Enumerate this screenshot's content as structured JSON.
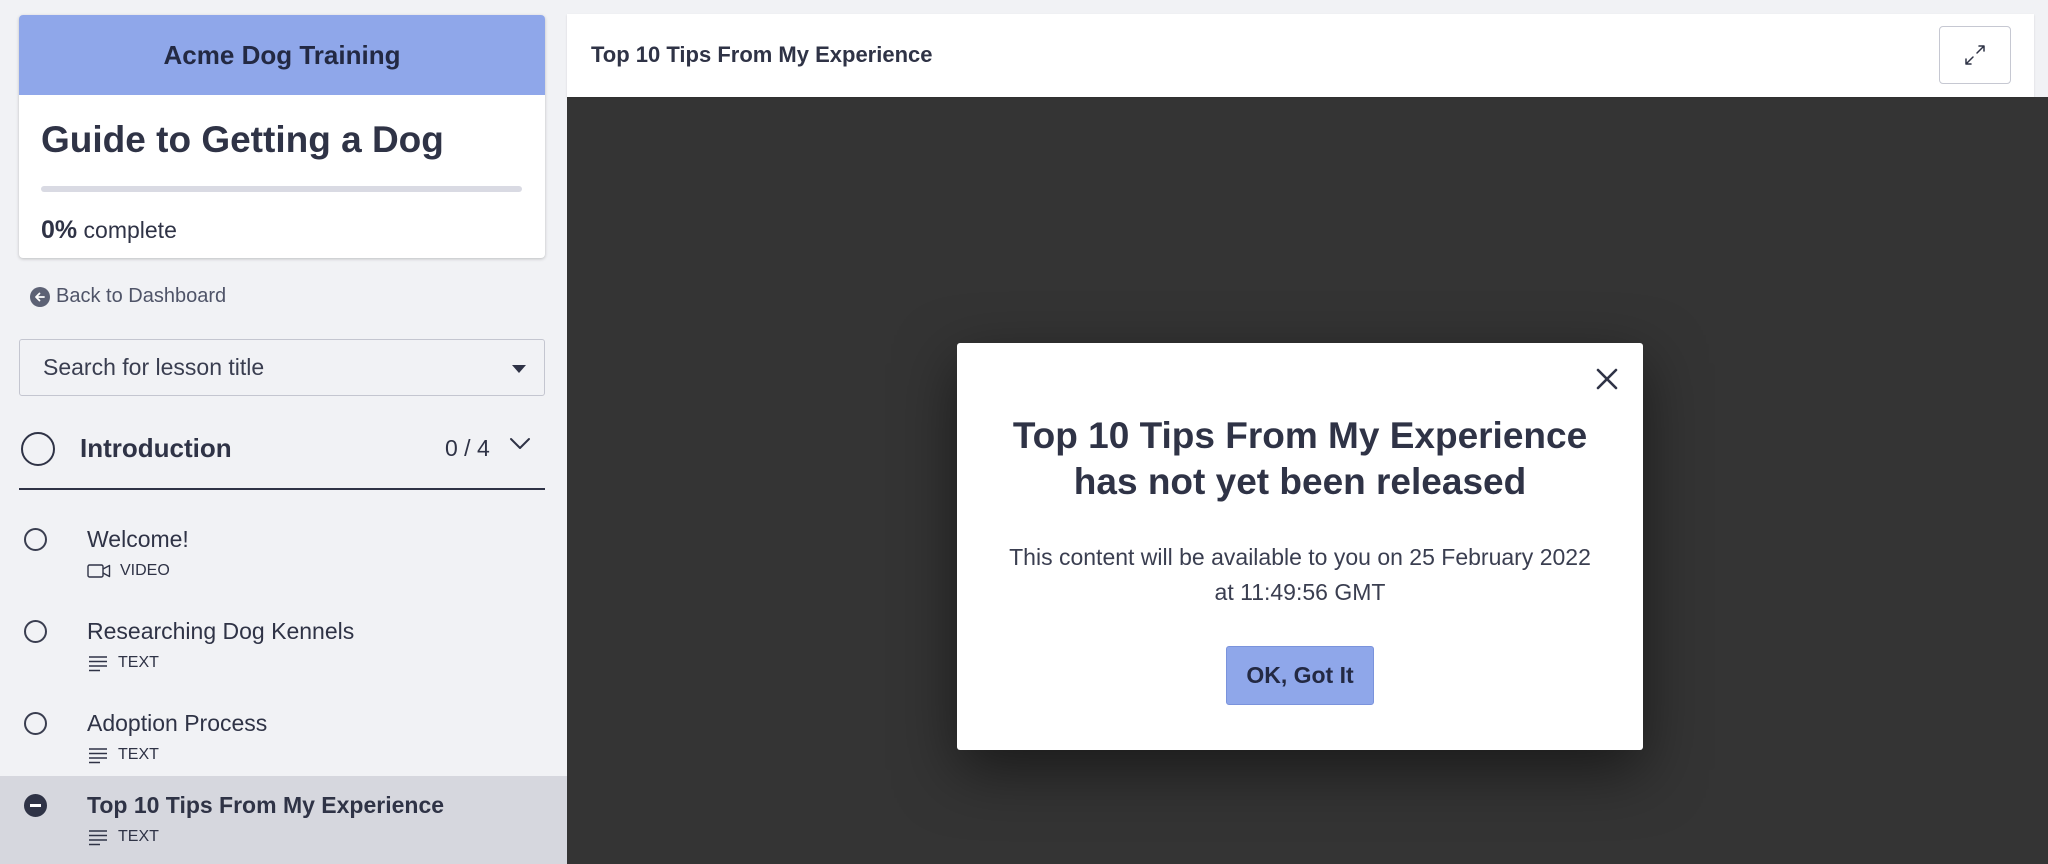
{
  "sidebar": {
    "school_name": "Acme Dog Training",
    "course_title": "Guide to Getting a Dog",
    "progress": {
      "percent_label": "0%",
      "suffix": "complete",
      "fraction": 0
    },
    "back_link": "Back to Dashboard",
    "search_placeholder": "Search for lesson title",
    "chapter": {
      "title": "Introduction",
      "count": "0 / 4"
    },
    "lessons": [
      {
        "title": "Welcome!",
        "type": "VIDEO",
        "icon": "video-camera-icon",
        "state": "incomplete"
      },
      {
        "title": "Researching Dog Kennels",
        "type": "TEXT",
        "icon": "text-lines-icon",
        "state": "incomplete"
      },
      {
        "title": "Adoption Process",
        "type": "TEXT",
        "icon": "text-lines-icon",
        "state": "incomplete"
      },
      {
        "title": "Top 10 Tips From My Experience",
        "type": "TEXT",
        "icon": "text-lines-icon",
        "state": "current"
      }
    ]
  },
  "main": {
    "lesson_title": "Top 10 Tips From My Experience",
    "expand_icon": "expand-arrows-icon"
  },
  "modal": {
    "heading": "Top 10 Tips From My Experience has not yet been released",
    "body": "This content will be available to you on 25 February 2022 at 11:49:56 GMT",
    "button_label": "OK, Got It",
    "close_icon": "close-icon"
  },
  "colors": {
    "accent": "#8fa7ea",
    "text": "#2f3346",
    "content_background": "#343434",
    "sidebar_background": "#f1f2f5",
    "active_lesson_background": "#d6d7de"
  }
}
